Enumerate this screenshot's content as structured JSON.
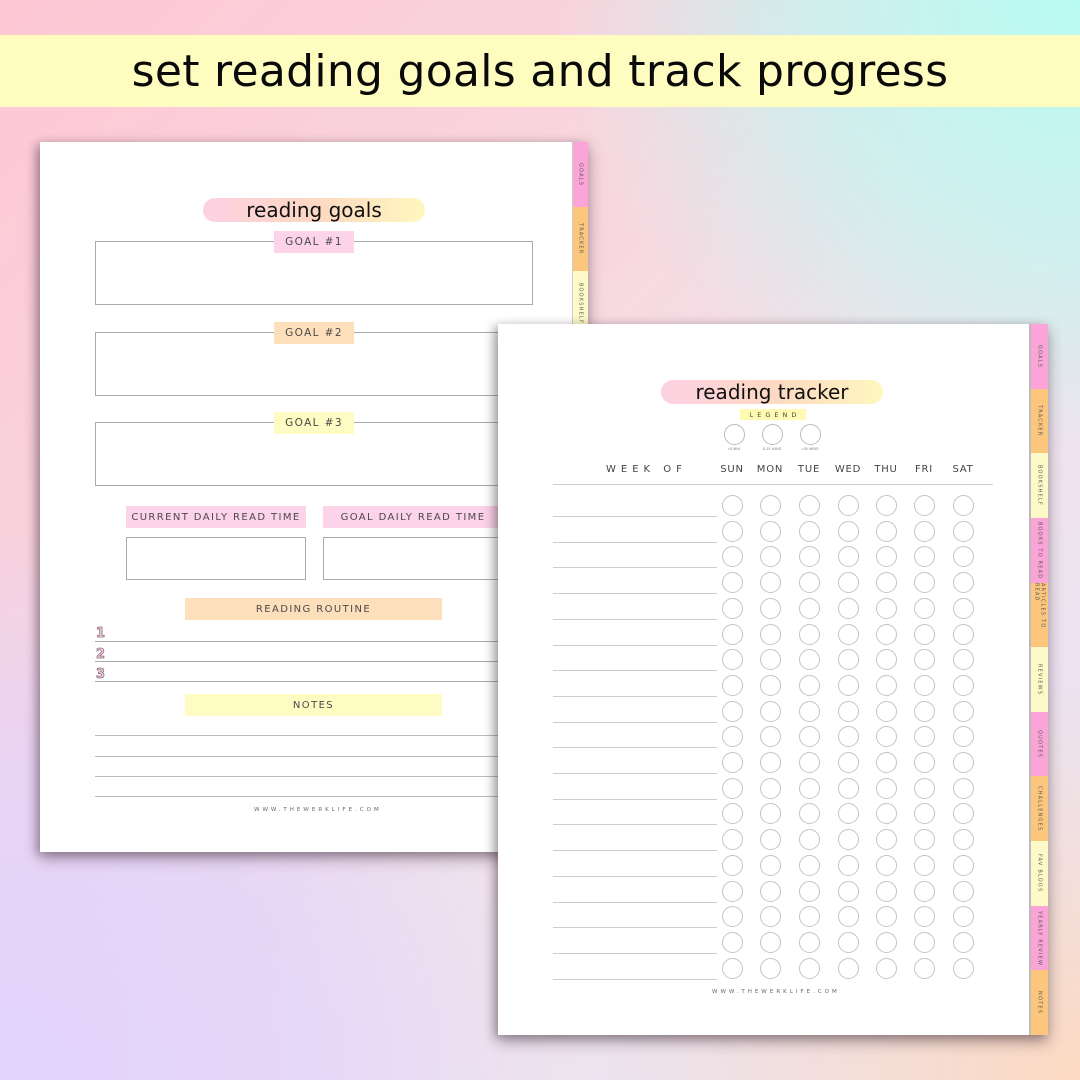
{
  "banner": {
    "headline": "set reading goals and track progress"
  },
  "colors": {
    "banner_bg": "#fffcc0",
    "tab_pink": "#fba4d8",
    "tab_orange": "#fdc67d",
    "tab_yellow": "#fefac8",
    "chip_pink": "#fdd3ea",
    "chip_orange": "#fde0bb",
    "chip_yellow": "#fefbc3"
  },
  "tabs": [
    {
      "label": "GOALS",
      "color": "pink"
    },
    {
      "label": "TRACKER",
      "color": "orange"
    },
    {
      "label": "BOOKSHELF",
      "color": "yellow"
    },
    {
      "label": "BOOKS TO READ",
      "color": "pink"
    },
    {
      "label": "ARTICLES TO READ",
      "color": "orange"
    },
    {
      "label": "REVIEWS",
      "color": "yellow"
    },
    {
      "label": "QUOTES",
      "color": "pink"
    },
    {
      "label": "CHALLENGES",
      "color": "orange"
    },
    {
      "label": "FAV BLOGS",
      "color": "yellow"
    },
    {
      "label": "YEARLY REVIEW",
      "color": "pink"
    },
    {
      "label": "NOTES",
      "color": "orange"
    }
  ],
  "goals_page": {
    "title": "reading goals",
    "goals": [
      {
        "label": "GOAL #1",
        "value": ""
      },
      {
        "label": "GOAL #2",
        "value": ""
      },
      {
        "label": "GOAL #3",
        "value": ""
      }
    ],
    "current_daily_read_time": {
      "label": "CURRENT DAILY READ TIME",
      "value": ""
    },
    "goal_daily_read_time": {
      "label": "GOAL DAILY READ TIME",
      "value": ""
    },
    "reading_routine": {
      "label": "READING ROUTINE",
      "items": [
        "1",
        "2",
        "3"
      ]
    },
    "notes": {
      "label": "NOTES",
      "line_count": 4
    },
    "footer": "WWW.THEWERKLIFE.COM"
  },
  "tracker_page": {
    "title": "reading tracker",
    "legend": {
      "label": "LEGEND",
      "items": [
        "<5 MIN",
        "5-29 MINS",
        ">30 MINS"
      ]
    },
    "week_of_label": "WEEK OF",
    "days": [
      "SUN",
      "MON",
      "TUE",
      "WED",
      "THU",
      "FRI",
      "SAT"
    ],
    "row_count": 19,
    "footer": "WWW.THEWERKLIFE.COM"
  }
}
